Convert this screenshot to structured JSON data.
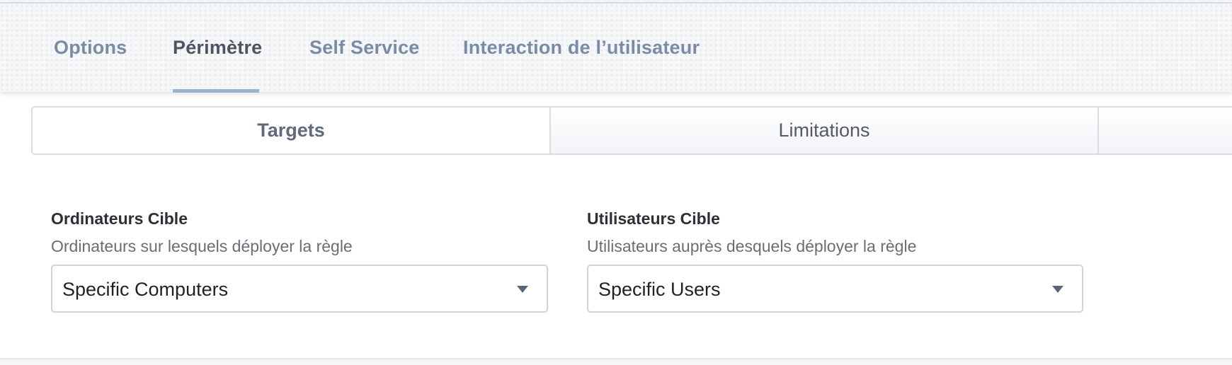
{
  "tabs": [
    {
      "label": "Options",
      "active": false
    },
    {
      "label": "Périmètre",
      "active": true
    },
    {
      "label": "Self Service",
      "active": false
    },
    {
      "label": "Interaction de l’utilisateur",
      "active": false
    }
  ],
  "segments": {
    "targets_label": "Targets",
    "limitations_label": "Limitations",
    "active": "Targets"
  },
  "target_computers": {
    "label": "Ordinateurs Cible",
    "description": "Ordinateurs sur lesquels déployer la règle",
    "selected": "Specific Computers",
    "icon": "chevron-down-icon"
  },
  "target_users": {
    "label": "Utilisateurs Cible",
    "description": "Utilisateurs auprès desquels déployer la règle",
    "selected": "Specific Users",
    "icon": "chevron-down-icon"
  },
  "colors": {
    "tab_inactive": "#7a8ca5",
    "tab_active": "#4d5563",
    "tab_underline": "#9db3cc"
  }
}
